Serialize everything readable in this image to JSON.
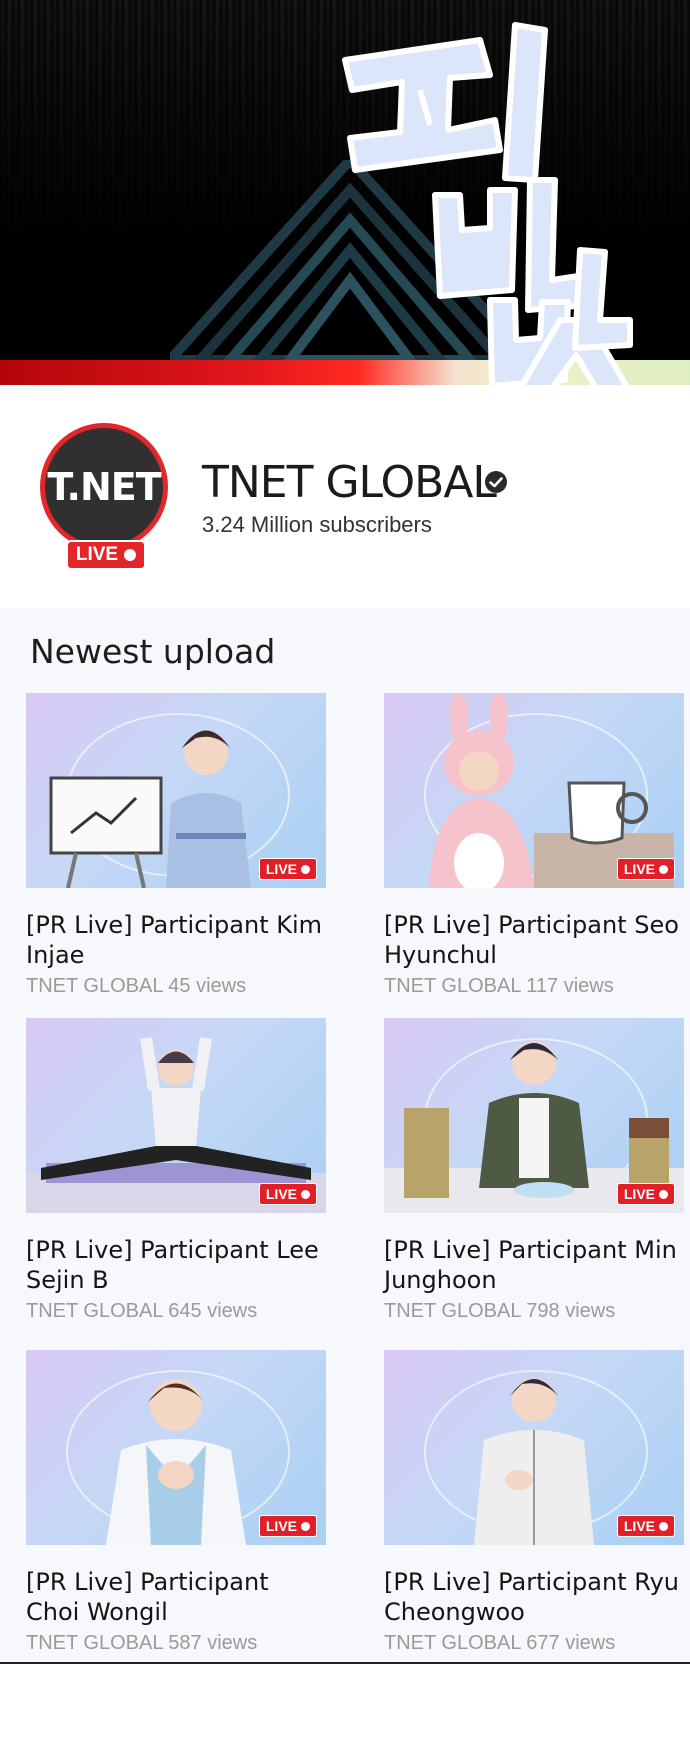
{
  "banner": {
    "calligraphy": "파바밧"
  },
  "channel": {
    "logo_text": "T.NET",
    "logo_badge": "LIVE",
    "name": "TNET GLOBAL",
    "subscribers": "3.24 Million subscribers"
  },
  "section": {
    "title": "Newest upload"
  },
  "colors": {
    "accent_red": "#e3262a",
    "thumb_bg": "#c6d8f6"
  },
  "videos": [
    {
      "badge": "LIVE",
      "title": "[PR Live] Participant Kim Injae",
      "channel": "TNET GLOBAL",
      "views": "45 views",
      "scene": "whiteboard-chart"
    },
    {
      "badge": "LIVE",
      "title": "[PR Live] Participant Seo Hyunchul",
      "channel": "TNET GLOBAL",
      "views": "117 views",
      "scene": "bunny-costume-mug"
    },
    {
      "badge": "LIVE",
      "title": "[PR Live] Participant Lee Sejin B",
      "channel": "TNET GLOBAL",
      "views": "645 views",
      "scene": "splits-stretch"
    },
    {
      "badge": "LIVE",
      "title": "[PR Live] Participant Min Junghoon",
      "channel": "TNET GLOBAL",
      "views": "798 views",
      "scene": "cups-waving"
    },
    {
      "badge": "LIVE",
      "title": "[PR Live] Participant Choi Wongil",
      "channel": "TNET GLOBAL",
      "views": "587 views",
      "scene": "hands-clasped"
    },
    {
      "badge": "LIVE",
      "title": "[PR Live] Participant Ryu Cheongwoo",
      "channel": "TNET GLOBAL",
      "views": "677 views",
      "scene": "track-jacket"
    }
  ]
}
